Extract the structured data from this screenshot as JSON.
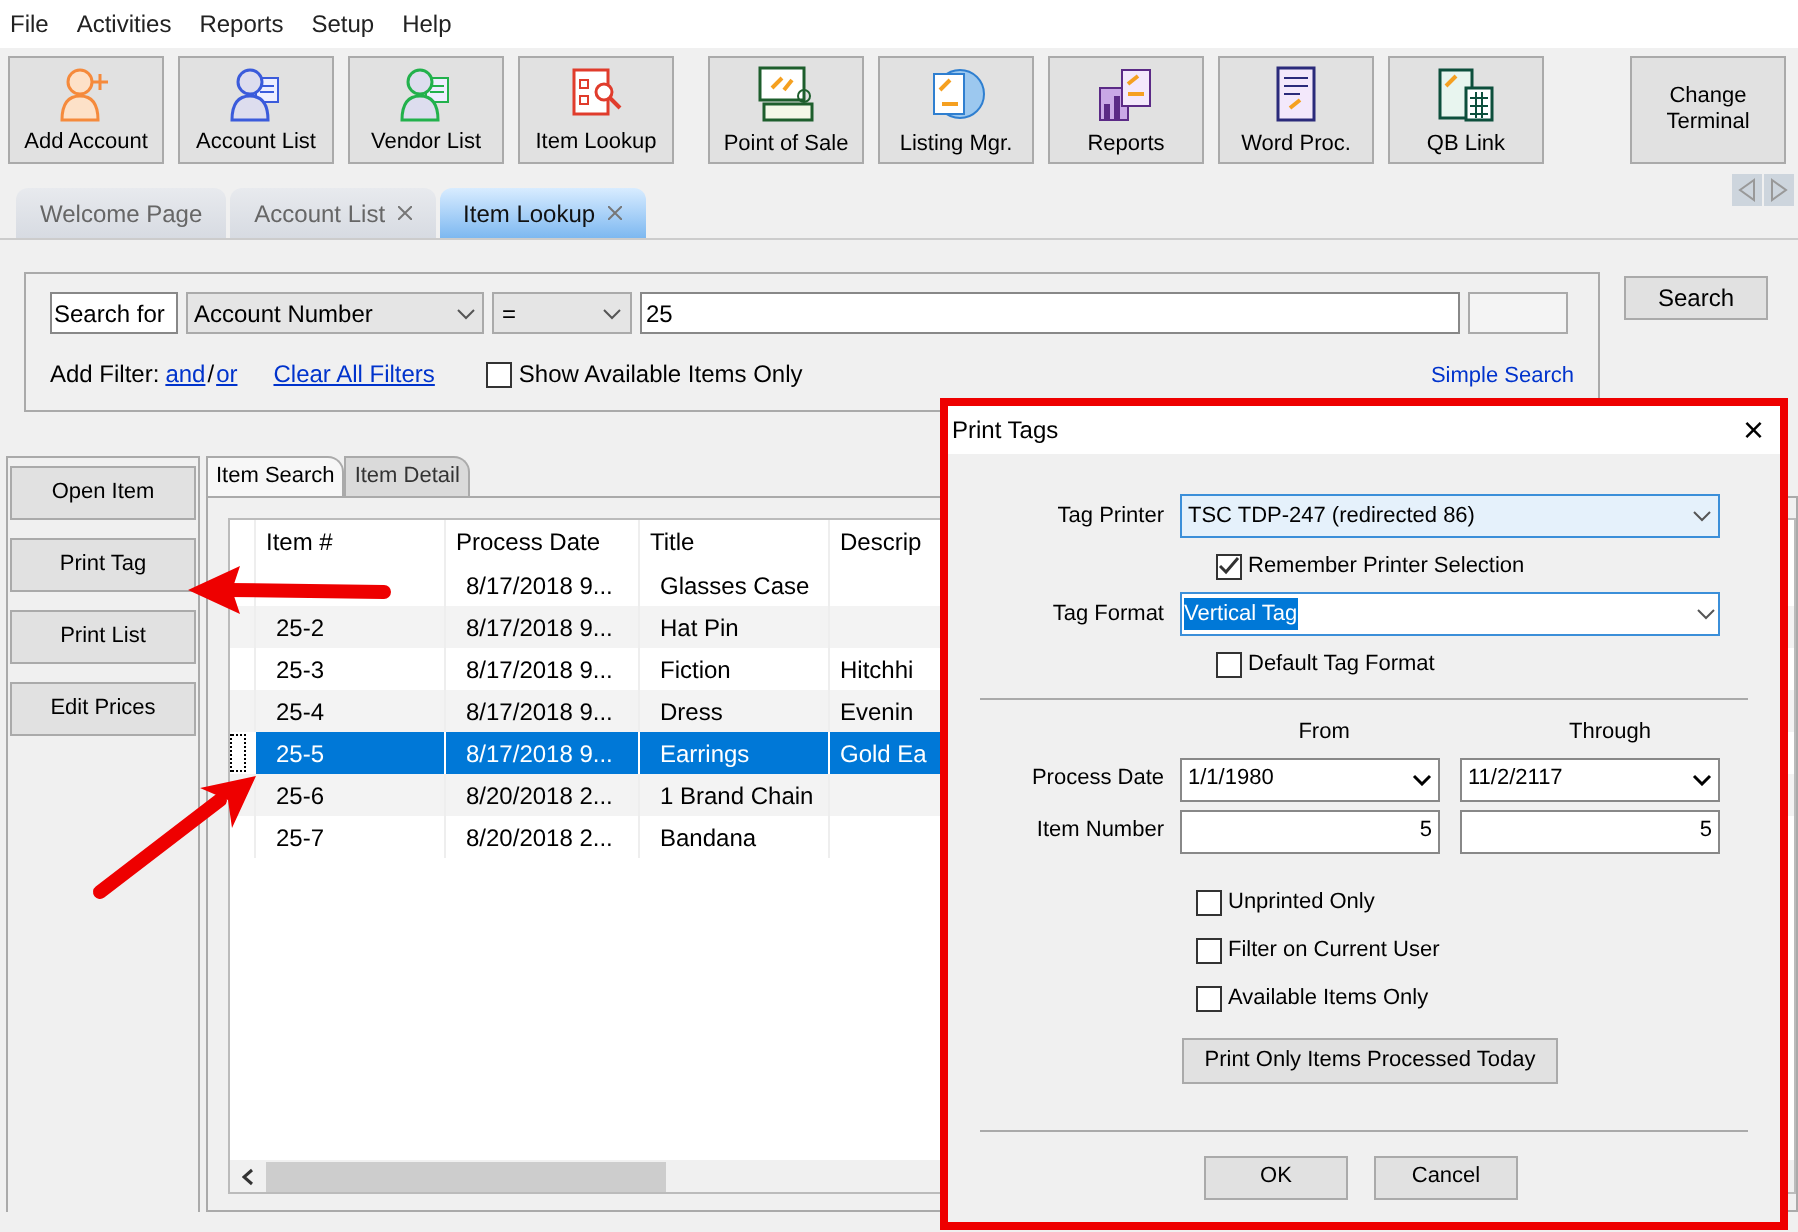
{
  "menu": [
    "File",
    "Activities",
    "Reports",
    "Setup",
    "Help"
  ],
  "toolbar": [
    {
      "label": "Add Account",
      "kind": "person-add",
      "color": "#f58a3c"
    },
    {
      "label": "Account List",
      "kind": "person-list",
      "color": "#3b5bdb"
    },
    {
      "label": "Vendor List",
      "kind": "person-list",
      "color": "#22b14c"
    },
    {
      "label": "Item Lookup",
      "kind": "lookup",
      "color": "#e03c2c"
    },
    {
      "label": "Point of Sale",
      "kind": "register",
      "color": "#1d5e2c"
    },
    {
      "label": "Listing Mgr.",
      "kind": "globe",
      "color": "#2f7fd0"
    },
    {
      "label": "Reports",
      "kind": "chart",
      "color": "#5b2a86"
    },
    {
      "label": "Word Proc.",
      "kind": "document",
      "color": "#2a2a7a"
    },
    {
      "label": "QB Link",
      "kind": "calculator",
      "color": "#0d4f3c"
    },
    {
      "label": "Change Terminal",
      "kind": "text"
    }
  ],
  "tabs": [
    {
      "label": "Welcome Page",
      "closable": false,
      "selected": false
    },
    {
      "label": "Account List",
      "closable": true,
      "selected": false
    },
    {
      "label": "Item Lookup",
      "closable": true,
      "selected": true
    }
  ],
  "search": {
    "label": "Search for",
    "field": "Account Number",
    "operator": "=",
    "value": "25",
    "add_filter": "Add Filter:",
    "and": "and",
    "separator": "/",
    "or": "or",
    "clear": "Clear All Filters",
    "show_available": {
      "label": "Show Available Items Only",
      "checked": false
    },
    "simple_search": "Simple Search",
    "button": "Search"
  },
  "side_buttons": [
    "Open Item",
    "Print Tag",
    "Print List",
    "Edit Prices"
  ],
  "subtabs": [
    {
      "label": "Item Search",
      "selected": true
    },
    {
      "label": "Item Detail",
      "selected": false
    }
  ],
  "table": {
    "columns": [
      "Item #",
      "Process Date",
      "Title",
      "Descrip"
    ],
    "rows": [
      {
        "cells": [
          "",
          "8/17/2018 9...",
          "Glasses Case",
          ""
        ],
        "selected": false
      },
      {
        "cells": [
          "25-2",
          "8/17/2018 9...",
          "Hat Pin",
          ""
        ],
        "selected": false
      },
      {
        "cells": [
          "25-3",
          "8/17/2018 9...",
          "Fiction",
          "Hitchhi"
        ],
        "selected": false
      },
      {
        "cells": [
          "25-4",
          "8/17/2018 9...",
          "Dress",
          "Evenin"
        ],
        "selected": false
      },
      {
        "cells": [
          "25-5",
          "8/17/2018 9...",
          "Earrings",
          "Gold Ea"
        ],
        "selected": true
      },
      {
        "cells": [
          "25-6",
          "8/20/2018 2...",
          "1 Brand Chain",
          ""
        ],
        "selected": false
      },
      {
        "cells": [
          "25-7",
          "8/20/2018 2...",
          "Bandana",
          ""
        ],
        "selected": false
      }
    ]
  },
  "dialog": {
    "title": "Print Tags",
    "close": "×",
    "tag_printer": {
      "label": "Tag Printer",
      "value": "TSC TDP-247 (redirected 86)"
    },
    "remember": {
      "label": "Remember Printer Selection",
      "checked": true
    },
    "tag_format": {
      "label": "Tag Format",
      "value": "Vertical Tag",
      "text_selected": true
    },
    "default_format": {
      "label": "Default Tag Format",
      "checked": false
    },
    "from_label": "From",
    "through_label": "Through",
    "process_date": {
      "label": "Process Date",
      "from": "1/1/1980",
      "through": "11/2/2117"
    },
    "item_number": {
      "label": "Item Number",
      "from": "5",
      "through": "5"
    },
    "options": [
      {
        "label": "Unprinted Only",
        "checked": false
      },
      {
        "label": "Filter on Current User",
        "checked": false
      },
      {
        "label": "Available Items Only",
        "checked": false
      }
    ],
    "print_today": "Print Only Items  Processed Today",
    "ok": "OK",
    "cancel": "Cancel"
  }
}
